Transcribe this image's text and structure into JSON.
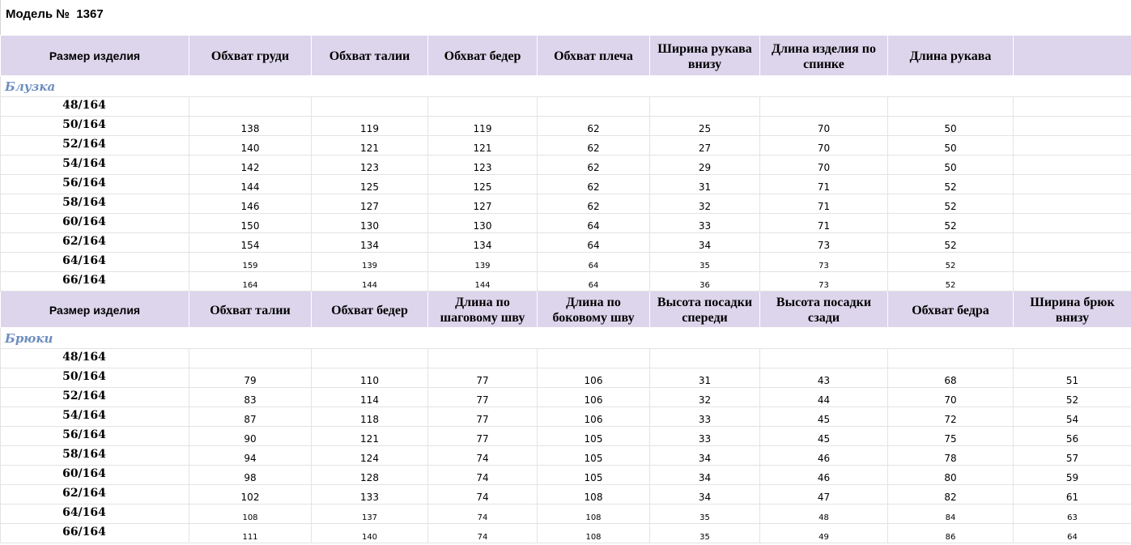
{
  "title": "Модель №  1367",
  "sections": [
    {
      "name": "Блузка",
      "headers": [
        "Размер изделия",
        "Обхват груди",
        "Обхват талии",
        "Обхват бедер",
        "Обхват плеча",
        "Ширина рукава внизу",
        "Длина изделия по спинке",
        "Длина рукава",
        ""
      ],
      "rows": [
        [
          "48/164",
          "",
          "",
          "",
          "",
          "",
          "",
          "",
          ""
        ],
        [
          "50/164",
          "138",
          "119",
          "119",
          "62",
          "25",
          "70",
          "50",
          ""
        ],
        [
          "52/164",
          "140",
          "121",
          "121",
          "62",
          "27",
          "70",
          "50",
          ""
        ],
        [
          "54/164",
          "142",
          "123",
          "123",
          "62",
          "29",
          "70",
          "50",
          ""
        ],
        [
          "56/164",
          "144",
          "125",
          "125",
          "62",
          "31",
          "71",
          "52",
          ""
        ],
        [
          "58/164",
          "146",
          "127",
          "127",
          "62",
          "32",
          "71",
          "52",
          ""
        ],
        [
          "60/164",
          "150",
          "130",
          "130",
          "64",
          "33",
          "71",
          "52",
          ""
        ],
        [
          "62/164",
          "154",
          "134",
          "134",
          "64",
          "34",
          "73",
          "52",
          ""
        ],
        [
          "64/164",
          "159",
          "139",
          "139",
          "64",
          "35",
          "73",
          "52",
          ""
        ],
        [
          "66/164",
          "164",
          "144",
          "144",
          "64",
          "36",
          "73",
          "52",
          ""
        ]
      ]
    },
    {
      "name": "Брюки",
      "headers": [
        "Размер изделия",
        "Обхват талии",
        "Обхват бедер",
        "Длина по шаговому шву",
        "Длина по боковому шву",
        "Высота посадки спереди",
        "Высота посадки сзади",
        "Обхват бедра",
        "Ширина брюк внизу"
      ],
      "rows": [
        [
          "48/164",
          "",
          "",
          "",
          "",
          "",
          "",
          "",
          ""
        ],
        [
          "50/164",
          "79",
          "110",
          "77",
          "106",
          "31",
          "43",
          "68",
          "51"
        ],
        [
          "52/164",
          "83",
          "114",
          "77",
          "106",
          "32",
          "44",
          "70",
          "52"
        ],
        [
          "54/164",
          "87",
          "118",
          "77",
          "106",
          "33",
          "45",
          "72",
          "54"
        ],
        [
          "56/164",
          "90",
          "121",
          "77",
          "105",
          "33",
          "45",
          "75",
          "56"
        ],
        [
          "58/164",
          "94",
          "124",
          "74",
          "105",
          "34",
          "46",
          "78",
          "57"
        ],
        [
          "60/164",
          "98",
          "128",
          "74",
          "105",
          "34",
          "46",
          "80",
          "59"
        ],
        [
          "62/164",
          "102",
          "133",
          "74",
          "108",
          "34",
          "47",
          "82",
          "61"
        ],
        [
          "64/164",
          "108",
          "137",
          "74",
          "108",
          "35",
          "48",
          "84",
          "63"
        ],
        [
          "66/164",
          "111",
          "140",
          "74",
          "108",
          "35",
          "49",
          "86",
          "64"
        ]
      ]
    }
  ]
}
